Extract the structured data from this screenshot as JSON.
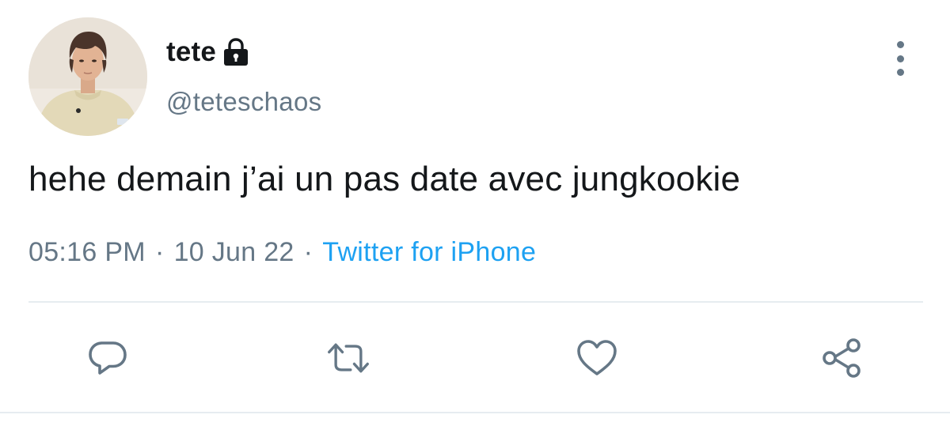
{
  "tweet": {
    "display_name": "tete",
    "handle": "@teteschaos",
    "text": "hehe demain j’ai un pas date avec jungkookie",
    "time": "05:16 PM",
    "separator": "·",
    "date": "10 Jun 22",
    "source": "Twitter for iPhone",
    "protected_icon": "lock-icon"
  },
  "actions": [
    {
      "name": "reply",
      "icon": "comment-icon"
    },
    {
      "name": "retweet",
      "icon": "retweet-icon"
    },
    {
      "name": "like",
      "icon": "heart-icon"
    },
    {
      "name": "share",
      "icon": "share-icon"
    }
  ],
  "colors": {
    "text": "#14171a",
    "secondary": "#657786",
    "link": "#1da1f2",
    "divider": "#e6ecf0"
  }
}
